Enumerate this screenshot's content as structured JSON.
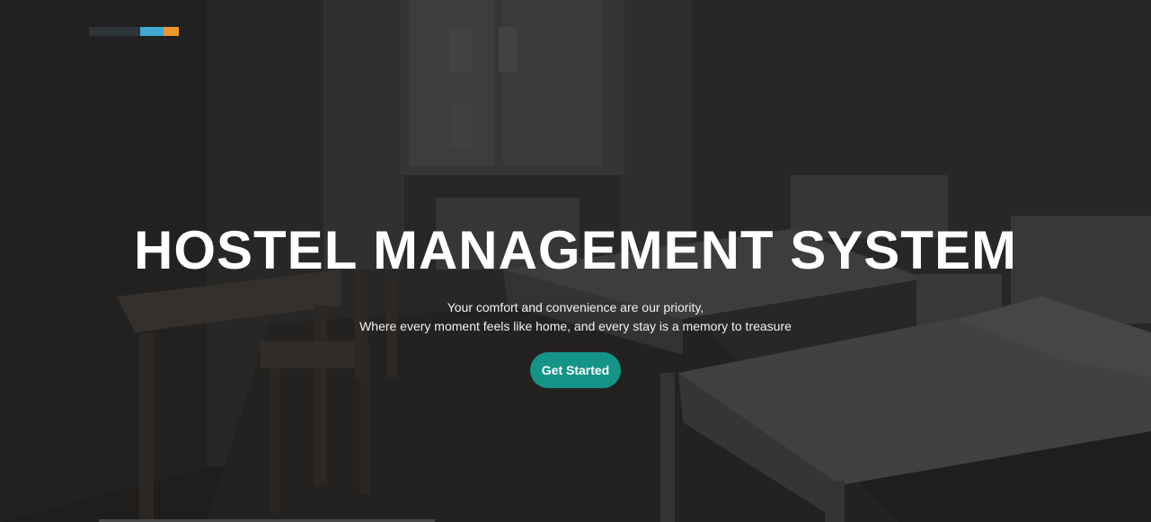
{
  "logo": {
    "colors": [
      "#2e3538",
      "#3fa9d1",
      "#f0962b"
    ]
  },
  "hero": {
    "title": "HOSTEL MANAGEMENT SYSTEM",
    "subtitle_line1": "Your comfort and convenience are our priority,",
    "subtitle_line2": "Where every moment feels like home, and every stay is a memory to treasure",
    "cta_label": "Get Started",
    "accent_color": "#149487"
  }
}
